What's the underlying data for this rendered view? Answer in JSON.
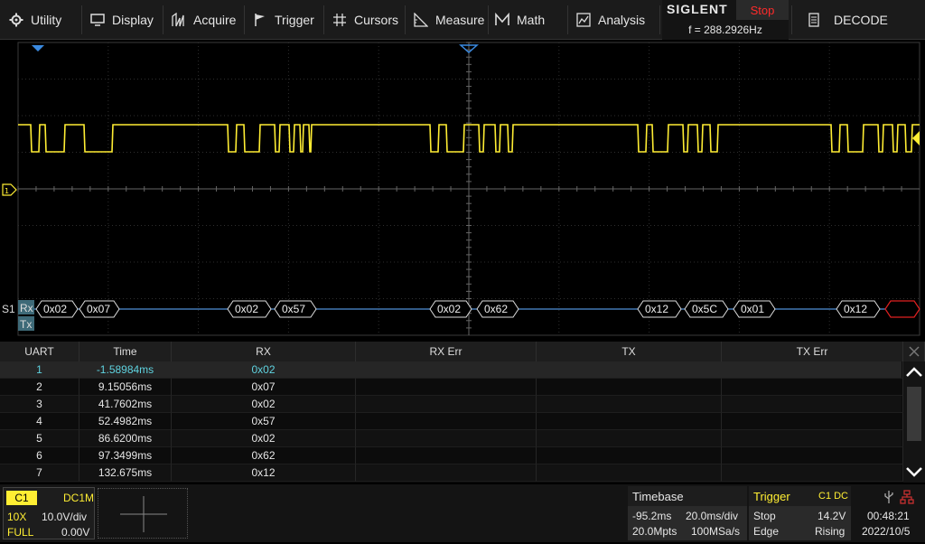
{
  "menu": {
    "utility": "Utility",
    "display": "Display",
    "acquire": "Acquire",
    "trigger": "Trigger",
    "cursors": "Cursors",
    "measure": "Measure",
    "math": "Math",
    "analysis": "Analysis",
    "decode": "DECODE"
  },
  "brand": {
    "logo": "SIGLENT",
    "status": "Stop",
    "frequency": "f = 288.2926Hz"
  },
  "scope": {
    "bus_label": "S1",
    "rx_label": "Rx",
    "tx_label": "Tx",
    "frames": [
      {
        "text": "0x02",
        "start": 0,
        "end": 1
      },
      {
        "text": "0x07",
        "start": 1,
        "end": 2
      },
      {
        "text": "0x02",
        "start": 2,
        "end": 3
      },
      {
        "text": "0x57",
        "start": 3,
        "end": 4
      },
      {
        "text": "0x02",
        "start": 4,
        "end": 5
      },
      {
        "text": "0x62",
        "start": 5,
        "end": 6
      },
      {
        "text": "0x12",
        "start": 6,
        "end": 7
      },
      {
        "text": "0x5C",
        "start": 7,
        "end": 8
      },
      {
        "text": "0x01",
        "start": 8,
        "end": 9
      },
      {
        "text": "0x12",
        "start": 9,
        "end": 10
      }
    ],
    "colors": {
      "signal": "#ffee33",
      "bus": "#4f8fd8",
      "error": "#e02020",
      "grid": "#3a3a3a"
    }
  },
  "decode_table": {
    "headers": [
      "UART",
      "Time",
      "RX",
      "RX Err",
      "TX",
      "TX Err"
    ],
    "rows": [
      [
        "1",
        "-1.58984ms",
        "0x02",
        "",
        "",
        ""
      ],
      [
        "2",
        "9.15056ms",
        "0x07",
        "",
        "",
        ""
      ],
      [
        "3",
        "41.7602ms",
        "0x02",
        "",
        "",
        ""
      ],
      [
        "4",
        "52.4982ms",
        "0x57",
        "",
        "",
        ""
      ],
      [
        "5",
        "86.6200ms",
        "0x02",
        "",
        "",
        ""
      ],
      [
        "6",
        "97.3499ms",
        "0x62",
        "",
        "",
        ""
      ],
      [
        "7",
        "132.675ms",
        "0x12",
        "",
        "",
        ""
      ]
    ]
  },
  "channel": {
    "name": "C1",
    "coupling": "DC1M",
    "probe": "10X",
    "vdiv": "10.0V/div",
    "bw": "FULL",
    "offset": "0.00V"
  },
  "timebase": {
    "title": "Timebase",
    "delay": "-95.2ms",
    "tdiv": "20.0ms/div",
    "points": "20.0Mpts",
    "rate": "100MSa/s"
  },
  "trigger": {
    "title": "Trigger",
    "source": "C1 DC",
    "mode": "Stop",
    "level": "14.2V",
    "type": "Edge",
    "slope": "Rising"
  },
  "clock": {
    "time": "00:48:21",
    "date": "2022/10/5"
  }
}
